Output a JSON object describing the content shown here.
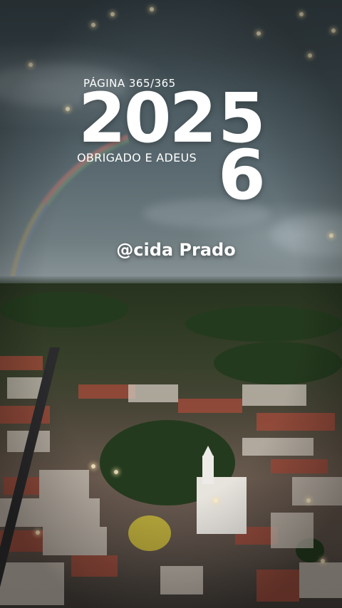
{
  "overlay": {
    "page_label": "PÁGINA 365/365",
    "year_prefix": "202",
    "year_old_digit": "5",
    "year_new_digit": "6",
    "farewell": "OBRIGADO E ADEUS",
    "handle": "@cida Prado"
  },
  "colors": {
    "text": "#ffffff",
    "sky": "#4b5b61",
    "land": "#37402a",
    "roof": "#a04a3a",
    "sparkle": "#fff0c8"
  }
}
